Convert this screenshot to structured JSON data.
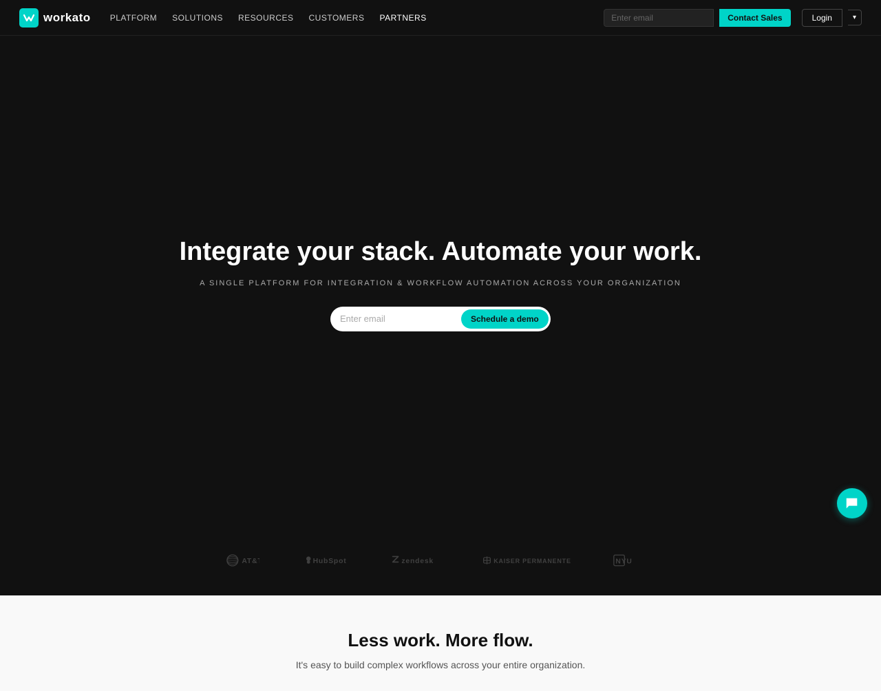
{
  "nav": {
    "logo_text": "workato",
    "links": [
      {
        "label": "PLATFORM",
        "key": "platform"
      },
      {
        "label": "SOLUTIONS",
        "key": "solutions"
      },
      {
        "label": "RESOURCES",
        "key": "resources"
      },
      {
        "label": "CUSTOMERS",
        "key": "customers"
      },
      {
        "label": "PARTNERS",
        "key": "partners"
      }
    ],
    "email_placeholder": "Enter email",
    "contact_sales_label": "Contact Sales",
    "login_label": "Login"
  },
  "hero": {
    "title": "Integrate your stack. Automate your work.",
    "subtitle": "A SINGLE PLATFORM FOR INTEGRATION & WORKFLOW AUTOMATION ACROSS YOUR ORGANIZATION",
    "email_placeholder": "Enter email",
    "cta_label": "Schedule a demo"
  },
  "logos": [
    {
      "name": "AT&T",
      "icon": "att"
    },
    {
      "name": "HubSpot",
      "icon": "hubspot"
    },
    {
      "name": "Zendesk",
      "icon": "zendesk"
    },
    {
      "name": "Kaiser Permanente",
      "icon": "kaiser"
    },
    {
      "name": "NYU",
      "icon": "nyu"
    }
  ],
  "bottom": {
    "title": "Less work. More flow.",
    "subtitle": "It's easy to build complex workflows across your entire organization."
  },
  "chat": {
    "label": "Chat"
  }
}
